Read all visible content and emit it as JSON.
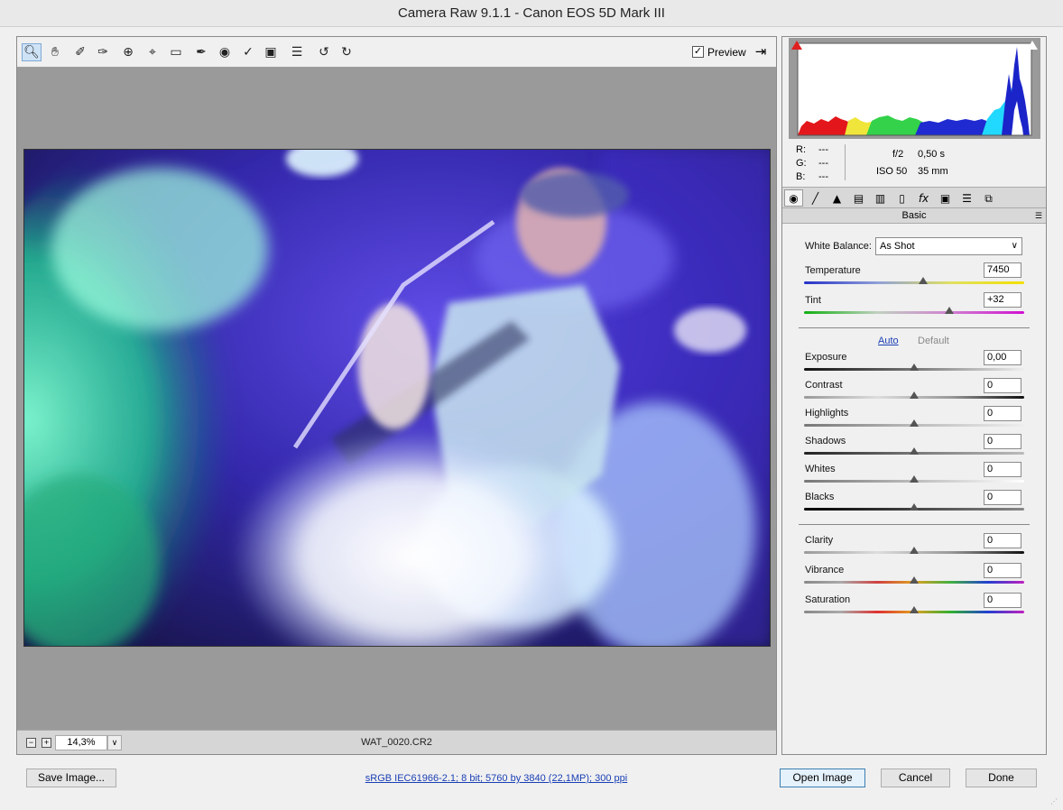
{
  "window": {
    "title": "Camera Raw 9.1.1  -  Canon EOS 5D Mark III"
  },
  "toolbar": {
    "tools": [
      "zoom-icon",
      "hand-icon",
      "white-balance-icon",
      "color-sampler-icon",
      "targeted-adjustment-icon",
      "crop-icon",
      "straighten-icon",
      "spot-removal-icon",
      "red-eye-icon",
      "adjustment-brush-icon",
      "graduated-filter-icon",
      "radial-filter-icon",
      "rotate-ccw-icon",
      "rotate-cw-icon"
    ],
    "preview_label": "Preview",
    "preview_checked": true
  },
  "status": {
    "zoom": "14,3%",
    "filename": "WAT_0020.CR2"
  },
  "histogram": {
    "clip_shadow_color": "#e02020",
    "clip_highlight_color": "#ffffff"
  },
  "info": {
    "r_label": "R:",
    "g_label": "G:",
    "b_label": "B:",
    "r_value": "---",
    "g_value": "---",
    "b_value": "---",
    "aperture": "f/2",
    "shutter": "0,50 s",
    "iso": "ISO 50",
    "focal": "35 mm"
  },
  "panel": {
    "title": "Basic",
    "white_balance_label": "White Balance:",
    "white_balance_value": "As Shot",
    "auto_label": "Auto",
    "default_label": "Default",
    "sliders": {
      "temperature": {
        "label": "Temperature",
        "value": "7450",
        "level": 0.54
      },
      "tint": {
        "label": "Tint",
        "value": "+32",
        "level": 0.66
      },
      "exposure": {
        "label": "Exposure",
        "value": "0,00",
        "level": 0.5
      },
      "contrast": {
        "label": "Contrast",
        "value": "0",
        "level": 0.5
      },
      "highlights": {
        "label": "Highlights",
        "value": "0",
        "level": 0.5
      },
      "shadows": {
        "label": "Shadows",
        "value": "0",
        "level": 0.5
      },
      "whites": {
        "label": "Whites",
        "value": "0",
        "level": 0.5
      },
      "blacks": {
        "label": "Blacks",
        "value": "0",
        "level": 0.5
      },
      "clarity": {
        "label": "Clarity",
        "value": "0",
        "level": 0.5
      },
      "vibrance": {
        "label": "Vibrance",
        "value": "0",
        "level": 0.5
      },
      "saturation": {
        "label": "Saturation",
        "value": "0",
        "level": 0.5
      }
    }
  },
  "footer": {
    "save_label": "Save Image...",
    "workflow_info": "sRGB IEC61966-2.1; 8 bit; 5760 by 3840 (22,1MP); 300 ppi",
    "open_label": "Open Image",
    "cancel_label": "Cancel",
    "done_label": "Done"
  }
}
